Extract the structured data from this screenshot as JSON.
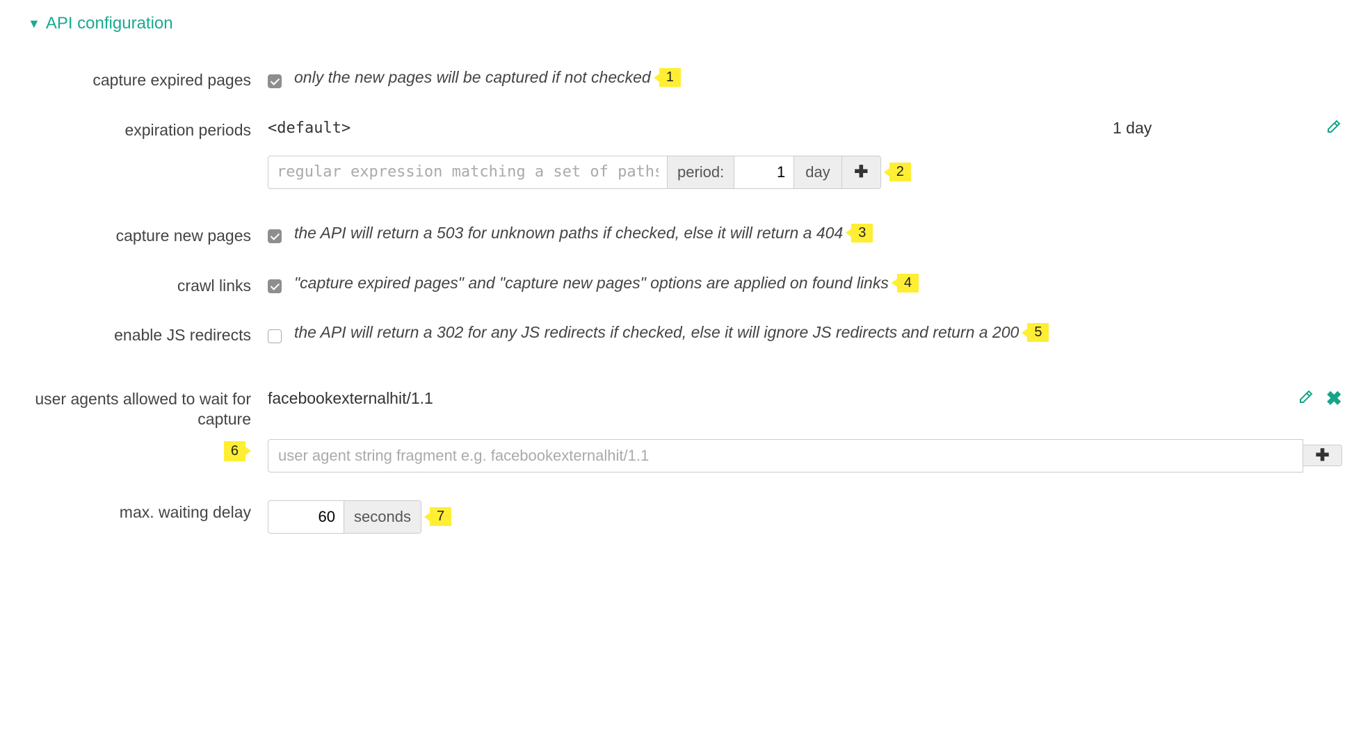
{
  "section": {
    "title": "API configuration"
  },
  "fields": {
    "capture_expired": {
      "label": "capture expired pages",
      "checked": true,
      "hint": "only the new pages will be captured if not checked",
      "badge": "1"
    },
    "expiration": {
      "label": "expiration periods",
      "default_name": "<default>",
      "default_period": "1 day",
      "regex_placeholder": "regular expression matching a set of paths e",
      "period_label": "period:",
      "period_value": "1",
      "period_unit": "day",
      "badge": "2"
    },
    "capture_new": {
      "label": "capture new pages",
      "checked": true,
      "hint": "the API will return a 503 for unknown paths if checked, else it will return a 404",
      "badge": "3"
    },
    "crawl_links": {
      "label": "crawl links",
      "checked": true,
      "hint": "\"capture expired pages\" and \"capture new pages\" options are applied on found links",
      "badge": "4"
    },
    "js_redirects": {
      "label": "enable JS redirects",
      "checked": false,
      "hint": "the API will return a 302 for any JS redirects if checked, else it will ignore JS redirects and return a 200",
      "badge": "5"
    },
    "user_agents": {
      "label": "user agents allowed to wait for capture",
      "items": [
        "facebookexternalhit/1.1"
      ],
      "placeholder": "user agent string fragment e.g. facebookexternalhit/1.1",
      "badge": "6"
    },
    "max_delay": {
      "label": "max. waiting delay",
      "value": "60",
      "unit": "seconds",
      "badge": "7"
    }
  }
}
